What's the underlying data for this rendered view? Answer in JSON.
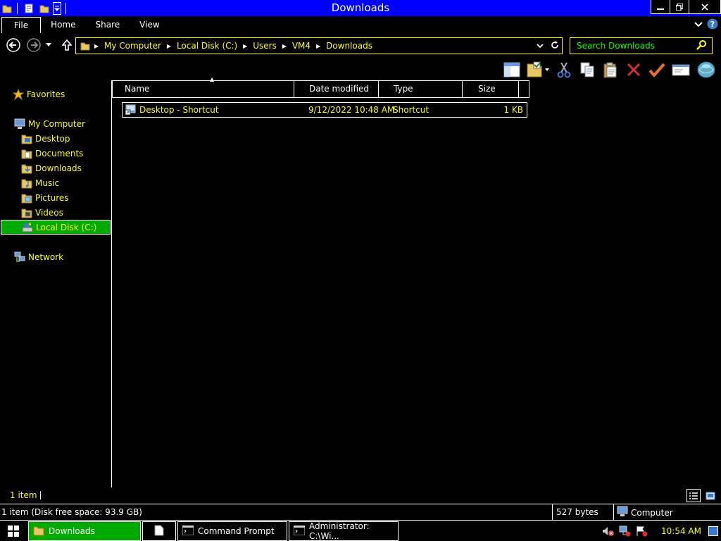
{
  "window": {
    "title": "Downloads"
  },
  "ribbon": {
    "tabs": [
      "File",
      "Home",
      "Share",
      "View"
    ]
  },
  "address": {
    "crumbs": [
      "My Computer",
      "Local Disk (C:)",
      "Users",
      "VM4",
      "Downloads"
    ]
  },
  "search": {
    "placeholder": "Search Downloads"
  },
  "nav": {
    "favorites": "Favorites",
    "computer": "My Computer",
    "items": [
      "Desktop",
      "Documents",
      "Downloads",
      "Music",
      "Pictures",
      "Videos",
      "Local Disk (C:)"
    ],
    "network": "Network"
  },
  "list": {
    "columns": [
      "Name",
      "Date modified",
      "Type",
      "Size"
    ],
    "rows": [
      {
        "name": "Desktop - Shortcut",
        "date": "9/12/2022 10:48 AM",
        "type": "Shortcut",
        "size": "1 KB"
      }
    ]
  },
  "status": {
    "items": "1 item",
    "disk": "1 item (Disk free space: 93.9 GB)",
    "size": "527 bytes",
    "computer": "Computer"
  },
  "taskbar": {
    "buttons": [
      "Downloads",
      "",
      "Command Prompt",
      "Administrator: C:\\Wi..."
    ],
    "clock": "10:54 AM"
  },
  "colors": {
    "title_bar": "#0000ff",
    "selection": "#00aa00",
    "text_link": "#ffff00",
    "placeholder": "#00ff00"
  }
}
